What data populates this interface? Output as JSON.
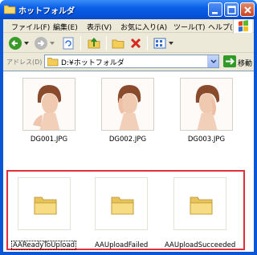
{
  "window": {
    "title": "ホットフォルダ"
  },
  "menu": [
    "ファイル(F)",
    "編集(E)",
    "表示(V)",
    "お気に入り(A)",
    "ツール(T)",
    "ヘルプ(H)"
  ],
  "address": {
    "label": "アドレス(D)",
    "path": "D:¥ホットフォルダ",
    "go_label": "移動"
  },
  "images": [
    {
      "filename": "DG001.JPG"
    },
    {
      "filename": "DG002.JPG"
    },
    {
      "filename": "DG003.JPG"
    }
  ],
  "folders": [
    {
      "name": "AAReadyToUpload",
      "selected": true
    },
    {
      "name": "AAUploadFailed",
      "selected": false
    },
    {
      "name": "AAUploadSucceeded",
      "selected": false
    }
  ],
  "highlight_color": "#e0303a"
}
